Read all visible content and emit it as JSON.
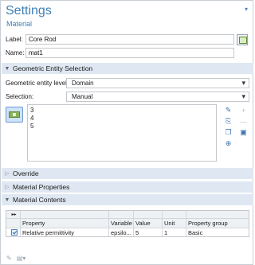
{
  "header": {
    "title": "Settings",
    "subtitle": "Material",
    "pin_icon": "pin-icon"
  },
  "fields": {
    "label_caption": "Label:",
    "label_value": "Core Rod",
    "name_caption": "Name:",
    "name_value": "mat1"
  },
  "geometric_entity_selection": {
    "title": "Geometric Entity Selection",
    "level_caption": "Geometric entity level:",
    "level_value": "Domain",
    "selection_caption": "Selection:",
    "selection_value": "Manual",
    "items": [
      "3",
      "4",
      "5"
    ],
    "tools": [
      "select-icon",
      "paste-icon",
      "copy-icon",
      "zoom-icon",
      "add-icon",
      "remove-icon",
      "clear-icon"
    ]
  },
  "sections": {
    "override": "Override",
    "material_properties": "Material Properties",
    "material_contents": "Material Contents"
  },
  "table": {
    "columns": [
      "Property",
      "Variable",
      "Value",
      "Unit",
      "Property group"
    ],
    "rows": [
      {
        "checked": true,
        "property": "Relative permittivity",
        "variable": "epsilo...",
        "value": "5",
        "unit": "1",
        "group": "Basic"
      }
    ]
  },
  "colors": {
    "accent": "#3f7fb6",
    "section_bg": "#dfe8f2"
  }
}
